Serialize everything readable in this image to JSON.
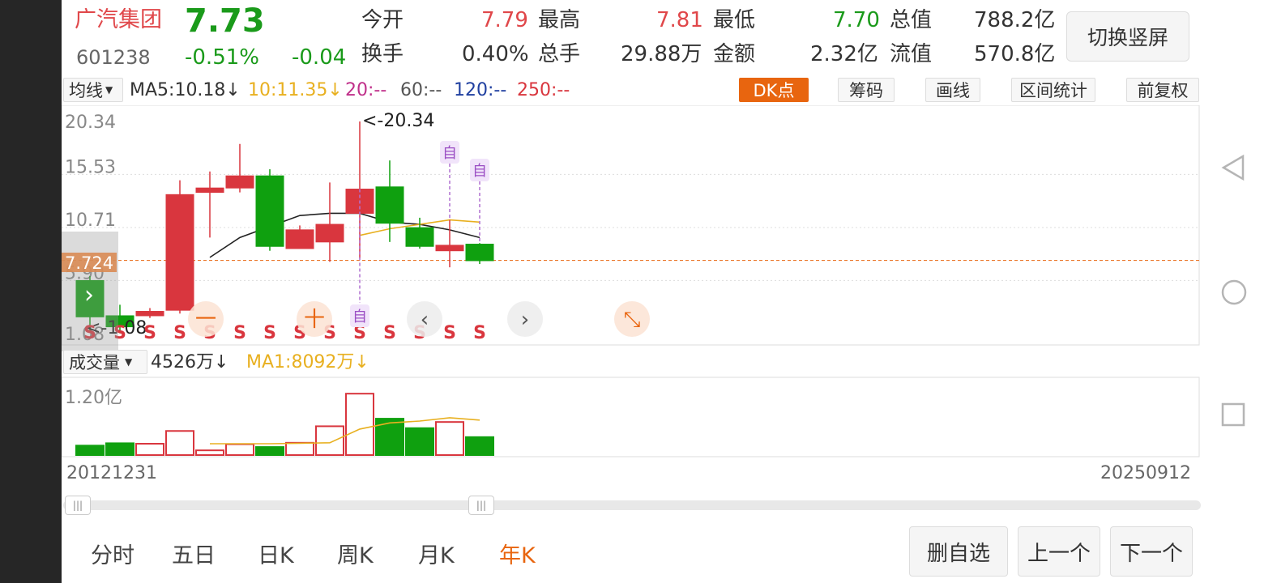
{
  "stock": {
    "name": "广汽集团",
    "price": "7.73",
    "code": "601238",
    "change_pct": "-0.51%",
    "change": "-0.04"
  },
  "quote": {
    "open_label": "今开",
    "open": "7.79",
    "high_label": "最高",
    "high": "7.81",
    "low_label": "最低",
    "low": "7.70",
    "mcap_label": "总值",
    "mcap": "788.2亿",
    "turnover_label": "换手",
    "turnover": "0.40%",
    "volume_label": "总手",
    "volume": "29.88万",
    "amount_label": "金额",
    "amount": "2.32亿",
    "float_label": "流值",
    "float_mcap": "570.8亿"
  },
  "toggle_label": "切换竖屏",
  "ma_bar": {
    "selector": "均线",
    "ma5": "MA5:10.18↓",
    "ma10": "10:11.35↓",
    "ma20": "20:--",
    "ma60": "60:--",
    "ma120": "120:--",
    "ma250": "250:--"
  },
  "tools": {
    "dk": "DK点",
    "chips": "筹码",
    "draw": "画线",
    "interval": "区间统计",
    "adjust": "前复权"
  },
  "price_axis": {
    "labels": [
      "20.34",
      "15.53",
      "10.71",
      "5.90",
      "1.08"
    ],
    "current": "7.724",
    "max_marker": "<-20.34",
    "min_marker": "<-1.08"
  },
  "markers": {
    "self_label": "自",
    "s_label": "S"
  },
  "volume_bar": {
    "selector": "成交量",
    "vol": "4526万↓",
    "ma1": "MA1:8092万↓",
    "axis_label": "1.20亿"
  },
  "date_range": {
    "start": "20121231",
    "end": "20250912"
  },
  "overlay": {
    "minus": "一",
    "plus": "十"
  },
  "tabs": [
    "分时",
    "五日",
    "日K",
    "周K",
    "月K",
    "年K"
  ],
  "buttons": {
    "remove": "删自选",
    "prev": "上一个",
    "next": "下一个"
  },
  "colors": {
    "up": "#d9363e",
    "down": "#0fa00f",
    "accent": "#e8650f",
    "ma10": "#e8b020"
  },
  "chart_data": {
    "type": "candlestick",
    "period": "年K",
    "y_range": [
      1.08,
      20.34
    ],
    "candles": [
      {
        "open": 5.9,
        "close": 2.6,
        "high": 6.3,
        "low": 1.3
      },
      {
        "open": 2.7,
        "close": 1.7,
        "high": 3.7,
        "low": 1.1
      },
      {
        "open": 2.7,
        "close": 3.1,
        "high": 3.4,
        "low": 2.5
      },
      {
        "open": 3.2,
        "close": 13.7,
        "high": 15.0,
        "low": 2.9
      },
      {
        "open": 13.9,
        "close": 14.3,
        "high": 15.8,
        "low": 9.8
      },
      {
        "open": 14.3,
        "close": 15.4,
        "high": 18.3,
        "low": 13.9
      },
      {
        "open": 15.4,
        "close": 9.0,
        "high": 16.0,
        "low": 8.6
      },
      {
        "open": 8.8,
        "close": 10.5,
        "high": 10.9,
        "low": 8.8
      },
      {
        "open": 9.4,
        "close": 11.0,
        "high": 14.8,
        "low": 7.6
      },
      {
        "open": 12.0,
        "close": 14.2,
        "high": 20.34,
        "low": 7.9
      },
      {
        "open": 14.4,
        "close": 11.1,
        "high": 16.8,
        "low": 9.4
      },
      {
        "open": 10.7,
        "close": 9.0,
        "high": 11.6,
        "low": 8.8
      },
      {
        "open": 8.6,
        "close": 9.1,
        "high": 11.4,
        "low": 7.1
      },
      {
        "open": 9.2,
        "close": 7.7,
        "high": 9.3,
        "low": 7.4
      }
    ],
    "ma5": [
      null,
      null,
      null,
      null,
      8.0,
      9.8,
      10.8,
      11.8,
      12.0,
      12.0,
      11.2,
      11.0,
      10.5,
      9.8
    ],
    "ma10": [
      null,
      null,
      null,
      null,
      null,
      null,
      null,
      null,
      null,
      10.0,
      10.6,
      11.0,
      11.4,
      11.2
    ],
    "volume": [
      0.2,
      0.25,
      0.24,
      0.51,
      0.1,
      0.23,
      0.17,
      0.26,
      0.61,
      1.3,
      0.77,
      0.57,
      0.7,
      0.38
    ],
    "volume_ma": [
      null,
      null,
      null,
      null,
      0.24,
      0.24,
      0.24,
      0.25,
      0.26,
      0.55,
      0.68,
      0.72,
      0.79,
      0.74
    ],
    "volume_axis_max": 1.2
  }
}
